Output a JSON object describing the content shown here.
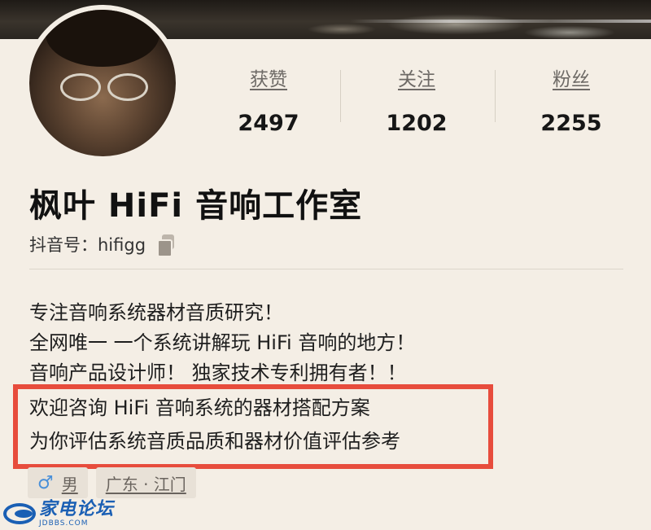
{
  "profile": {
    "name": "枫叶 HiFi 音响工作室",
    "account_id": "抖音号：hifigg"
  },
  "stats": {
    "likes": {
      "label": "获赞",
      "value": "2497"
    },
    "following": {
      "label": "关注",
      "value": "1202"
    },
    "followers": {
      "label": "粉丝",
      "value": "2255"
    }
  },
  "bio": {
    "lines": [
      "专注音响系统器材音质研究！",
      "全网唯一 一个系统讲解玩 HiFi 音响的地方！",
      "音响产品设计师！ 独家技术专利拥有者！！"
    ],
    "highlighted_lines": [
      "欢迎咨询 HiFi 音响系统的器材搭配方案",
      "为你评估系统音质品质和器材价值评估参考"
    ],
    "highlight_color": "#e74c3c"
  },
  "tags": {
    "gender": {
      "icon": "male-icon",
      "label": "男"
    },
    "location": "广东 · 江门"
  },
  "watermark": {
    "title": "家电论坛",
    "subtitle": "JDBBS.COM",
    "color": "#1a5fb4"
  },
  "icons": {
    "copy": "copy-icon",
    "gender": "male-icon"
  }
}
